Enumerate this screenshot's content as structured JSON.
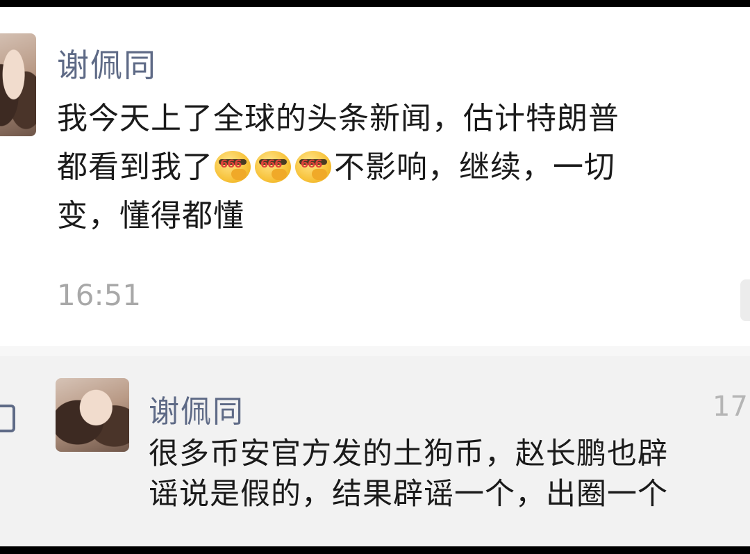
{
  "messages": [
    {
      "sender": "谢佩同",
      "lines": [
        "我今天上了全球的头条新闻，估计特朗普",
        "都看到我了",
        "不影响，继续，一切",
        "变，懂得都懂"
      ],
      "emoji": [
        "sunglasses-666-emoji",
        "sunglasses-666-emoji",
        "sunglasses-666-emoji"
      ],
      "emoji_label": "666",
      "time": "16:51"
    },
    {
      "sender": "谢佩同",
      "lines": [
        "很多币安官方发的土狗币，赵长鹏也辟",
        "谣说是假的，结果辟谣一个，出圈一个"
      ],
      "time": "17:"
    }
  ]
}
